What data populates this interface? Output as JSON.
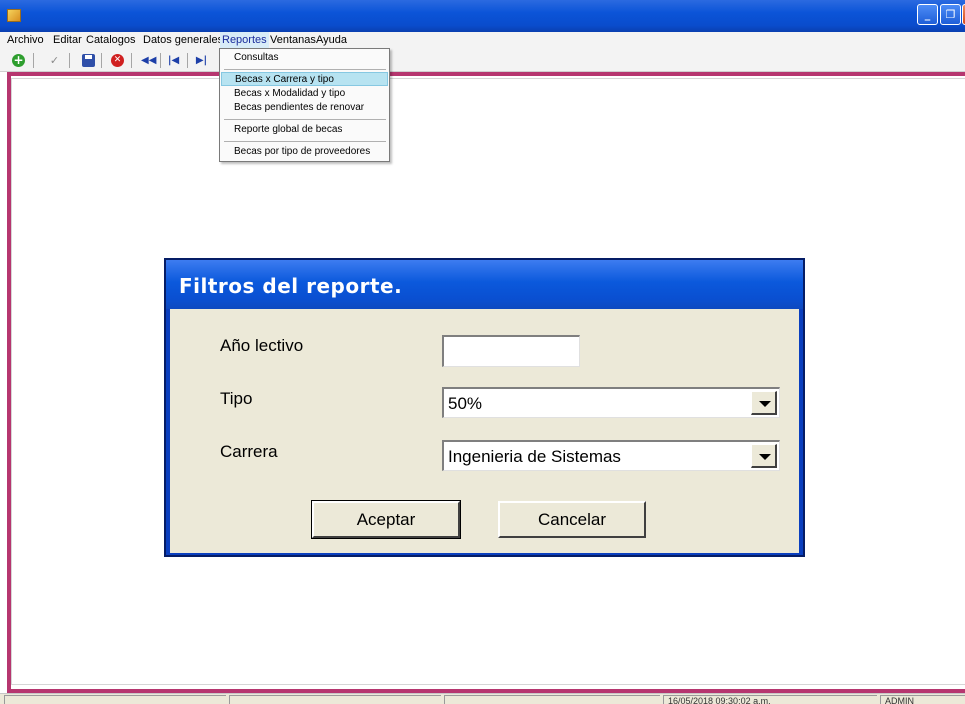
{
  "window": {
    "minimize_glyph": "_",
    "maximize_glyph": "❐",
    "close_glyph": "✕"
  },
  "menu": {
    "items": [
      "Archivo",
      "Editar",
      "Catalogos",
      "Datos generales",
      "Reportes",
      "Ventanas",
      "Ayuda"
    ],
    "active": "Reportes"
  },
  "toolbar": {
    "icons": [
      "add-icon",
      "check-icon",
      "save-icon",
      "cancel-icon",
      "rewind-icon",
      "first-icon",
      "last-icon"
    ],
    "colors": {
      "add": "#2e9e2e",
      "save": "#2f4fa8",
      "cancel": "#d02020",
      "nav": "#1d3fa8"
    }
  },
  "reportes_menu": {
    "items": [
      "Consultas",
      "Becas x Carrera y tipo",
      "Becas x Modalidad y tipo",
      "Becas pendientes de renovar",
      "Reporte global de becas",
      "Becas por tipo de proveedores"
    ],
    "highlighted": "Becas x Carrera y tipo"
  },
  "dialog": {
    "title": "Filtros del reporte.",
    "ano_label": "Año lectivo",
    "ano_value": "",
    "tipo_label": "Tipo",
    "tipo_value": "50%",
    "carrera_label": "Carrera",
    "carrera_value": "Ingenieria de Sistemas",
    "accept_label": "Aceptar",
    "cancel_label": "Cancelar"
  },
  "status": {
    "datetime": "16/05/2018 09:30:02 a.m.",
    "user": "ADMIN"
  },
  "colors": {
    "mdi_border": "#b6366f",
    "title_blue": "#0b54d8",
    "dialog_body": "#ece9d8",
    "menu_highlight": "#b7e3f1"
  }
}
